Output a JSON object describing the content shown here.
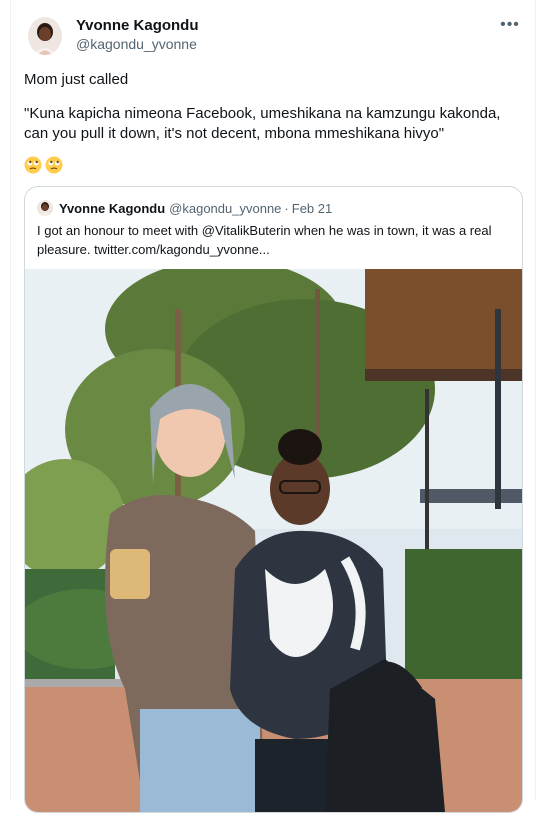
{
  "author": {
    "name": "Yvonne Kagondu",
    "handle": "@kagondu_yvonne"
  },
  "more_icon": "more-horizontal-icon",
  "tweet": {
    "line1": "Mom just called",
    "line2": "\"Kuna kapicha nimeona Facebook, umeshikana na kamzungu kakonda, can you pull it down, it's not decent, mbona mmeshikana hivyo\"",
    "emojis": [
      "rolling-eyes-emoji",
      "rolling-eyes-emoji"
    ]
  },
  "quoted_tweet": {
    "name": "Yvonne Kagondu",
    "handle": "@kagondu_yvonne",
    "separator": "·",
    "date": "Feb 21",
    "text": "I got an honour to meet with @VitalikButerin when he was in town, it was a real pleasure.  twitter.com/kagondu_yvonne..."
  },
  "colors": {
    "text_primary": "#0f1419",
    "text_secondary": "#536471",
    "border": "#cfd9de",
    "background": "#ffffff"
  }
}
